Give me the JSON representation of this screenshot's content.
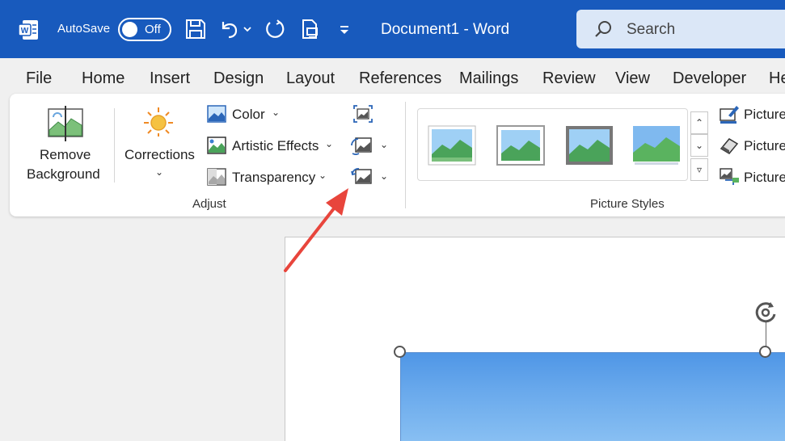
{
  "titlebar": {
    "autosave_label": "AutoSave",
    "autosave_state": "Off",
    "doc_title": "Document1  -  Word",
    "search_label": "Search",
    "accent": "#185abd"
  },
  "menu": [
    "File",
    "Home",
    "Insert",
    "Design",
    "Layout",
    "References",
    "Mailings",
    "Review",
    "View",
    "Developer",
    "He"
  ],
  "adjust": {
    "remove_bg_line1": "Remove",
    "remove_bg_line2": "Background",
    "corrections": "Corrections",
    "color": "Color",
    "artistic": "Artistic Effects",
    "transparency": "Transparency",
    "group_label": "Adjust"
  },
  "styles": {
    "group_label": "Picture Styles",
    "side": [
      "Picture",
      "Picture",
      "Picture"
    ]
  },
  "annotation": {
    "arrow_color": "#e8453c"
  }
}
